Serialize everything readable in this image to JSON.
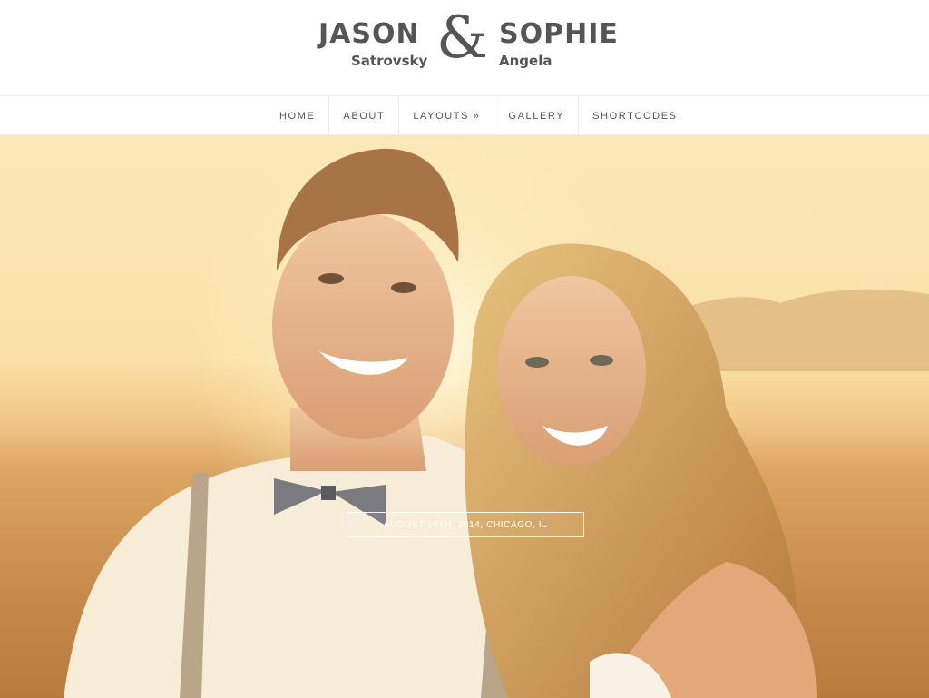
{
  "header": {
    "groom": {
      "first": "JASON",
      "last": "Satrovsky"
    },
    "ampersand": "&",
    "bride": {
      "first": "SOPHIE",
      "last": "Angela"
    }
  },
  "nav": {
    "items": [
      {
        "label": "HOME"
      },
      {
        "label": "ABOUT"
      },
      {
        "label": "LAYOUTS »"
      },
      {
        "label": "GALLERY"
      },
      {
        "label": "SHORTCODES"
      }
    ]
  },
  "hero": {
    "date_location": "AUGUST 10TH, 2014, CHICAGO, IL"
  },
  "colors": {
    "text": "#555555",
    "divider": "#ececec",
    "hero_sky": "#fbe7b8",
    "hero_field": "#c98c4c"
  }
}
